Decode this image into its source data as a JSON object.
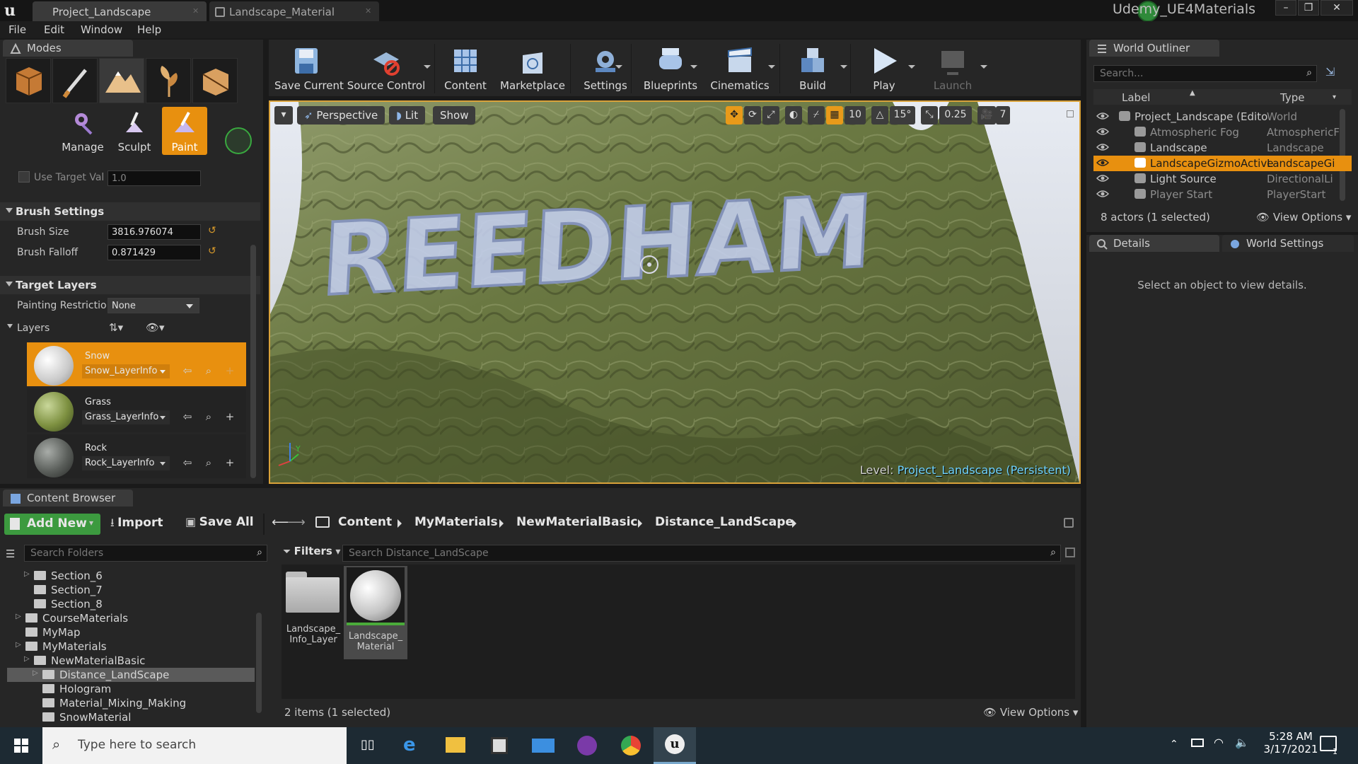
{
  "titlebar": {
    "tabs": [
      {
        "label": "Project_Landscape",
        "active": true
      },
      {
        "label": "Landscape_Material",
        "active": false
      }
    ],
    "project_name": "Udemy_UE4Materials"
  },
  "menu": [
    "File",
    "Edit",
    "Window",
    "Help"
  ],
  "modes": {
    "tab_label": "Modes",
    "tools": [
      "Manage",
      "Sculpt",
      "Paint"
    ],
    "selected_tool": "Paint",
    "use_target_value_label": "Use Target Val",
    "use_target_value": "1.0",
    "brush_settings": {
      "header": "Brush Settings",
      "brush_size_label": "Brush Size",
      "brush_size": "3816.976074",
      "brush_falloff_label": "Brush Falloff",
      "brush_falloff": "0.871429"
    },
    "target_layers": {
      "header": "Target Layers",
      "painting_restriction_label": "Painting Restrictio",
      "painting_restriction": "None",
      "layers_label": "Layers",
      "layers": [
        {
          "name": "Snow",
          "info": "Snow_LayerInfo",
          "selected": true
        },
        {
          "name": "Grass",
          "info": "Grass_LayerInfo",
          "selected": false
        },
        {
          "name": "Rock",
          "info": "Rock_LayerInfo",
          "selected": false
        }
      ]
    }
  },
  "toolbar": {
    "buttons": [
      "Save Current",
      "Source Control",
      "Content",
      "Marketplace",
      "Settings",
      "Blueprints",
      "Cinematics",
      "Build",
      "Play",
      "Launch"
    ]
  },
  "viewport": {
    "perspective": "Perspective",
    "lit": "Lit",
    "show": "Show",
    "grid_snap": "10",
    "rotation_snap": "15°",
    "scale_snap": "0.25",
    "camera_speed": "7",
    "painted_text": "REEDHAM",
    "level_prefix": "Level:",
    "level_name": "Project_Landscape (Persistent)"
  },
  "outliner": {
    "tab_label": "World Outliner",
    "search_placeholder": "Search...",
    "col_label": "Label",
    "col_type": "Type",
    "rows": [
      {
        "label": "Project_Landscape (Edito",
        "type": "World",
        "indent": 0,
        "dim": false,
        "selected": false
      },
      {
        "label": "Atmospheric Fog",
        "type": "AtmosphericF",
        "indent": 1,
        "dim": true,
        "selected": false
      },
      {
        "label": "Landscape",
        "type": "Landscape",
        "indent": 1,
        "dim": false,
        "selected": false
      },
      {
        "label": "LandscapeGizmoActive",
        "type": "LandscapeGi",
        "indent": 1,
        "dim": false,
        "selected": true
      },
      {
        "label": "Light Source",
        "type": "DirectionalLi",
        "indent": 1,
        "dim": false,
        "selected": false
      },
      {
        "label": "Player Start",
        "type": "PlayerStart",
        "indent": 1,
        "dim": true,
        "selected": false
      }
    ],
    "actor_count": "8 actors (1 selected)",
    "view_options": "View Options"
  },
  "details": {
    "tab_label": "Details",
    "world_settings_label": "World Settings",
    "empty_message": "Select an object to view details."
  },
  "content_browser": {
    "tab_label": "Content Browser",
    "add_new": "Add New",
    "import": "Import",
    "save_all": "Save All",
    "breadcrumbs": [
      "Content",
      "MyMaterials",
      "NewMaterialBasic",
      "Distance_LandScape"
    ],
    "search_folders_placeholder": "Search Folders",
    "filters": "Filters",
    "search_assets_placeholder": "Search Distance_LandScape",
    "folders": [
      {
        "label": "Section_6",
        "indent": 1,
        "expander": true,
        "selected": false
      },
      {
        "label": "Section_7",
        "indent": 1,
        "expander": false,
        "selected": false
      },
      {
        "label": "Section_8",
        "indent": 1,
        "expander": false,
        "selected": false
      },
      {
        "label": "CourseMaterials",
        "indent": 0,
        "expander": true,
        "selected": false
      },
      {
        "label": "MyMap",
        "indent": 0,
        "expander": false,
        "selected": false
      },
      {
        "label": "MyMaterials",
        "indent": 0,
        "expander": true,
        "selected": false
      },
      {
        "label": "NewMaterialBasic",
        "indent": 1,
        "expander": true,
        "selected": false
      },
      {
        "label": "Distance_LandScape",
        "indent": 2,
        "expander": true,
        "selected": true
      },
      {
        "label": "Hologram",
        "indent": 2,
        "expander": false,
        "selected": false
      },
      {
        "label": "Material_Mixing_Making",
        "indent": 2,
        "expander": false,
        "selected": false
      },
      {
        "label": "SnowMaterial",
        "indent": 2,
        "expander": false,
        "selected": false
      }
    ],
    "assets": [
      {
        "line1": "Landscape_",
        "line2": "Info_Layer",
        "kind": "folder",
        "selected": false
      },
      {
        "line1": "Landscape_",
        "line2": "Material",
        "kind": "material",
        "selected": true
      }
    ],
    "items_count": "2 items (1 selected)",
    "view_options": "View Options"
  },
  "taskbar": {
    "search_placeholder": "Type here to search",
    "time": "5:28 AM",
    "date": "3/17/2021",
    "notification_count": "1"
  },
  "colors": {
    "accent_orange": "#e8900f",
    "viewport_border": "#d9a23a",
    "level_link": "#6fd3ff"
  }
}
